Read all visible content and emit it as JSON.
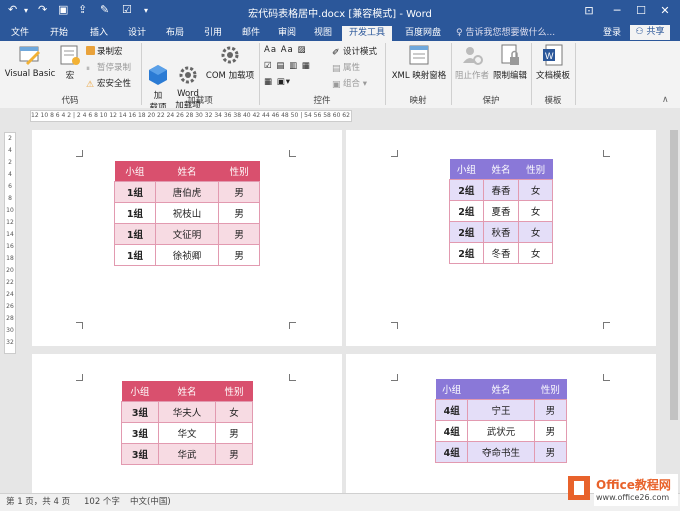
{
  "window": {
    "title": "宏代码表格居中.docx [兼容模式] - Word"
  },
  "tabs": [
    "文件",
    "开始",
    "插入",
    "设计",
    "布局",
    "引用",
    "邮件",
    "审阅",
    "视图",
    "开发工具",
    "百度网盘"
  ],
  "active_tab": "开发工具",
  "tell_me": "告诉我您想要做什么...",
  "account": {
    "login": "登录",
    "share": "共享"
  },
  "ribbon": {
    "code": {
      "visual_basic": "Visual Basic",
      "macro": "宏",
      "record": "录制宏",
      "pause": "暂停录制",
      "security": "宏安全性",
      "label": "代码"
    },
    "addins": {
      "addin": "加\n载项",
      "word_addin": "Word\n加载项",
      "com_addin": "COM 加载项",
      "label": "加载项"
    },
    "controls": {
      "design_mode": "设计模式",
      "properties": "属性",
      "group": "组合",
      "label": "控件"
    },
    "mapping": {
      "xml": "XML 映射窗格",
      "label": "映射"
    },
    "protect": {
      "block_authors": "阻止作者",
      "restrict": "限制编辑",
      "label": "保护"
    },
    "templates": {
      "doc_template": "文档模板",
      "label": "模板"
    }
  },
  "ruler": {
    "text": "12 10  8  6  4  2  |  2  4  6  8  10 12 14 16 18 20 22 24 26 28 30 32 34 36 38 40 42 44 46 48 50  |  54 56 58 60 62 64 66"
  },
  "vruler": [
    "2",
    "4",
    "2",
    "4",
    "6",
    "8",
    "10",
    "12",
    "14",
    "16",
    "18",
    "20",
    "22",
    "24",
    "26",
    "28",
    "30",
    "32"
  ],
  "tables": [
    {
      "headers": [
        "小组",
        "姓名",
        "性别"
      ],
      "rows": [
        [
          "1组",
          "唐伯虎",
          "男"
        ],
        [
          "1组",
          "祝枝山",
          "男"
        ],
        [
          "1组",
          "文征明",
          "男"
        ],
        [
          "1组",
          "徐祯卿",
          "男"
        ]
      ]
    },
    {
      "headers": [
        "小组",
        "姓名",
        "性别"
      ],
      "rows": [
        [
          "2组",
          "春香",
          "女"
        ],
        [
          "2组",
          "夏香",
          "女"
        ],
        [
          "2组",
          "秋香",
          "女"
        ],
        [
          "2组",
          "冬香",
          "女"
        ]
      ]
    },
    {
      "headers": [
        "小组",
        "姓名",
        "性别"
      ],
      "rows": [
        [
          "3组",
          "华夫人",
          "女"
        ],
        [
          "3组",
          "华文",
          "男"
        ],
        [
          "3组",
          "华武",
          "男"
        ]
      ]
    },
    {
      "headers": [
        "小组",
        "姓名",
        "性别"
      ],
      "rows": [
        [
          "4组",
          "宁王",
          "男"
        ],
        [
          "4组",
          "武状元",
          "男"
        ],
        [
          "4组",
          "夺命书生",
          "男"
        ]
      ]
    }
  ],
  "status": {
    "page": "第 1 页，共 4 页",
    "words": "102 个字",
    "language": "中文(中国)"
  },
  "watermark": {
    "brand": "Office教程网",
    "url": "www.office26.com"
  },
  "colors": {
    "word_blue": "#2b579a",
    "pink_header": "#d9506e",
    "purple_header": "#8a78d8"
  }
}
